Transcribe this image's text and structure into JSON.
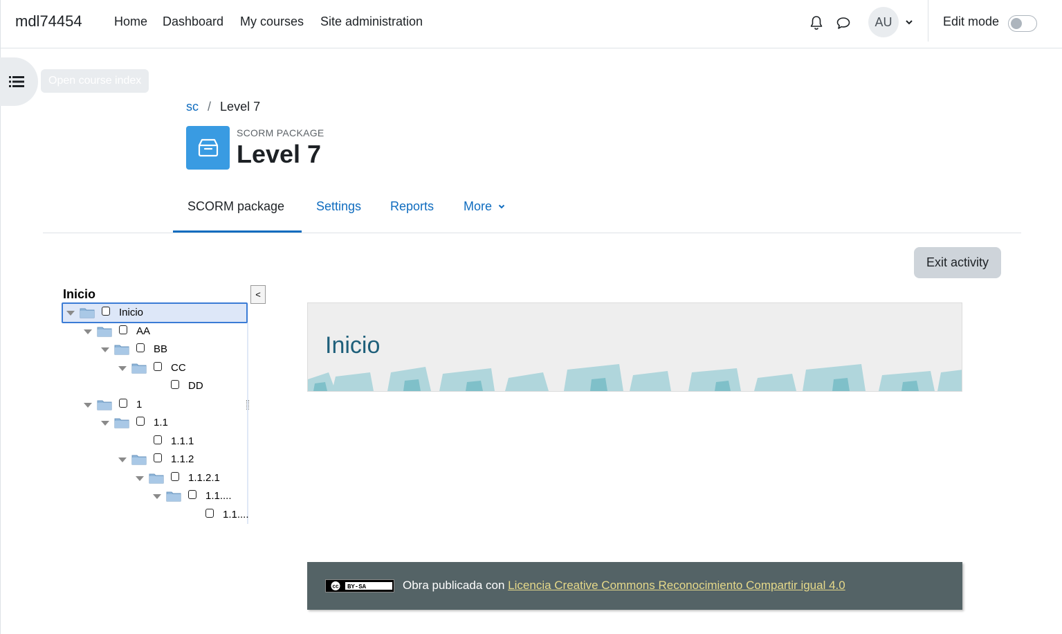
{
  "navbar": {
    "brand": "mdl74454",
    "links": [
      "Home",
      "Dashboard",
      "My courses",
      "Site administration"
    ],
    "avatar_initials": "AU",
    "edit_mode_label": "Edit mode",
    "edit_mode_on": false
  },
  "drawer": {
    "tooltip": "Open course index"
  },
  "breadcrumb": {
    "course": "sc",
    "separator": "/",
    "current": "Level 7"
  },
  "activity": {
    "type": "SCORM PACKAGE",
    "title": "Level 7",
    "icon_color": "#399be2"
  },
  "tabs": [
    {
      "label": "SCORM package",
      "active": true
    },
    {
      "label": "Settings",
      "active": false
    },
    {
      "label": "Reports",
      "active": false
    },
    {
      "label": "More",
      "active": false
    }
  ],
  "exit_button": "Exit activity",
  "toc": {
    "title": "Inicio",
    "collapse_label": "<",
    "items": [
      {
        "label": "Inicio",
        "level": 0,
        "folder": true,
        "selected": true
      },
      {
        "label": "AA",
        "level": 1,
        "folder": true
      },
      {
        "label": "BB",
        "level": 2,
        "folder": true
      },
      {
        "label": "CC",
        "level": 3,
        "folder": true
      },
      {
        "label": "DD",
        "level": 4,
        "folder": false
      },
      {
        "label": "1",
        "level": 1,
        "folder": true
      },
      {
        "label": "1.1",
        "level": 2,
        "folder": true
      },
      {
        "label": "1.1.1",
        "level": 3,
        "folder": false
      },
      {
        "label": "1.1.2",
        "level": 3,
        "folder": true
      },
      {
        "label": "1.1.2.1",
        "level": 4,
        "folder": true
      },
      {
        "label": "1.1....",
        "level": 5,
        "folder": true
      },
      {
        "label": "1.1....",
        "level": 6,
        "folder": false
      }
    ]
  },
  "content": {
    "banner_title": "Inicio",
    "footer_text": "Obra publicada con",
    "footer_link": "Licencia Creative Commons Reconocimiento Compartir igual 4.0",
    "cc_badge": "BY-SA"
  },
  "colors": {
    "link": "#0f6cbf",
    "footer_bg": "#546366",
    "footer_link": "#e6d98a"
  }
}
